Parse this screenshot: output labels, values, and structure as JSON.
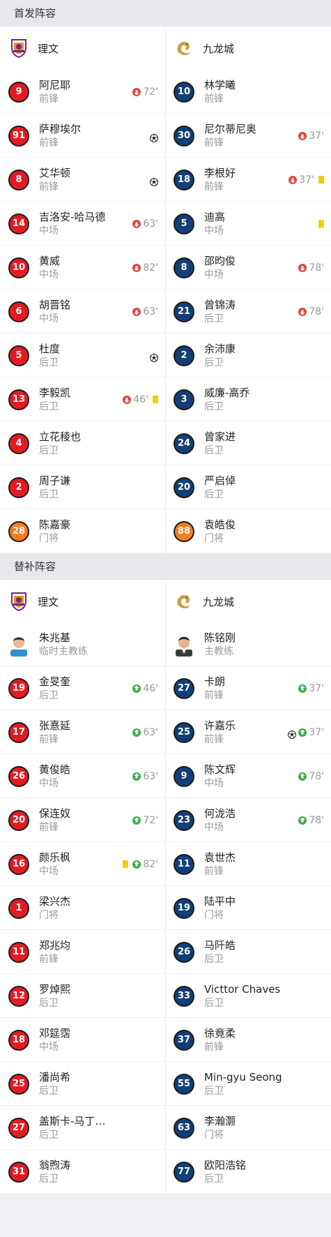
{
  "starting": {
    "title": "首发阵容",
    "home": {
      "team": "理文",
      "players": [
        {
          "number": "9",
          "name": "阿尼耶",
          "position": "前锋",
          "color": "red",
          "sub_out": "72'"
        },
        {
          "number": "91",
          "name": "萨穆埃尔",
          "position": "前锋",
          "color": "red",
          "goals": 1
        },
        {
          "number": "8",
          "name": "艾华顿",
          "position": "前锋",
          "color": "red",
          "goals": 1
        },
        {
          "number": "14",
          "name": "吉洛安-哈马德",
          "position": "中场",
          "color": "red",
          "sub_out": "63'"
        },
        {
          "number": "10",
          "name": "黄威",
          "position": "中场",
          "color": "red",
          "sub_out": "82'"
        },
        {
          "number": "6",
          "name": "胡晋铭",
          "position": "中场",
          "color": "red",
          "sub_out": "63'"
        },
        {
          "number": "5",
          "name": "杜度",
          "position": "后卫",
          "color": "red",
          "goals": 1
        },
        {
          "number": "13",
          "name": "李毅凯",
          "position": "后卫",
          "color": "red",
          "sub_out": "46'",
          "yellow": true
        },
        {
          "number": "4",
          "name": "立花稜也",
          "position": "后卫",
          "color": "red"
        },
        {
          "number": "2",
          "name": "周子谦",
          "position": "后卫",
          "color": "red"
        },
        {
          "number": "28",
          "name": "陈嘉豪",
          "position": "门将",
          "color": "orange"
        }
      ]
    },
    "away": {
      "team": "九龙城",
      "players": [
        {
          "number": "10",
          "name": "林学曦",
          "position": "前锋",
          "color": "navy"
        },
        {
          "number": "30",
          "name": "尼尔蒂尼奥",
          "position": "前锋",
          "color": "navy",
          "sub_out": "37'"
        },
        {
          "number": "18",
          "name": "李根好",
          "position": "前锋",
          "color": "navy",
          "sub_out": "37'",
          "yellow": true
        },
        {
          "number": "5",
          "name": "迪高",
          "position": "中场",
          "color": "navy",
          "yellow": true
        },
        {
          "number": "8",
          "name": "邵昀俊",
          "position": "中场",
          "color": "navy",
          "sub_out": "78'"
        },
        {
          "number": "21",
          "name": "曾锦涛",
          "position": "后卫",
          "color": "navy",
          "sub_out": "78'"
        },
        {
          "number": "2",
          "name": "余沛康",
          "position": "后卫",
          "color": "navy"
        },
        {
          "number": "3",
          "name": "威廉-高乔",
          "position": "后卫",
          "color": "navy"
        },
        {
          "number": "24",
          "name": "曾家进",
          "position": "后卫",
          "color": "navy"
        },
        {
          "number": "20",
          "name": "严启倬",
          "position": "后卫",
          "color": "navy"
        },
        {
          "number": "88",
          "name": "袁皓俊",
          "position": "门将",
          "color": "orange"
        }
      ]
    }
  },
  "substitutes": {
    "title": "替补阵容",
    "home": {
      "team": "理文",
      "coach": {
        "name": "朱兆基",
        "role": "临时主教练"
      },
      "players": [
        {
          "number": "19",
          "name": "金旻奎",
          "position": "后卫",
          "color": "red",
          "sub_in": "46'"
        },
        {
          "number": "17",
          "name": "张憙延",
          "position": "前锋",
          "color": "red",
          "sub_in": "63'"
        },
        {
          "number": "26",
          "name": "黄俊皓",
          "position": "中场",
          "color": "red",
          "sub_in": "63'"
        },
        {
          "number": "20",
          "name": "保连奴",
          "position": "前锋",
          "color": "red",
          "sub_in": "72'"
        },
        {
          "number": "16",
          "name": "颜乐枫",
          "position": "中场",
          "color": "red",
          "sub_in": "82'",
          "yellow": true
        },
        {
          "number": "1",
          "name": "梁兴杰",
          "position": "门将",
          "color": "red"
        },
        {
          "number": "11",
          "name": "郑兆均",
          "position": "前锋",
          "color": "red"
        },
        {
          "number": "12",
          "name": "罗焯熙",
          "position": "后卫",
          "color": "red"
        },
        {
          "number": "18",
          "name": "邓筵霑",
          "position": "中场",
          "color": "red"
        },
        {
          "number": "25",
          "name": "潘尚希",
          "position": "后卫",
          "color": "red"
        },
        {
          "number": "27",
          "name": "盖斯卡-马丁…",
          "position": "后卫",
          "color": "red"
        },
        {
          "number": "31",
          "name": "翁煦涛",
          "position": "后卫",
          "color": "red"
        }
      ]
    },
    "away": {
      "team": "九龙城",
      "coach": {
        "name": "陈铭刚",
        "role": "主教练"
      },
      "players": [
        {
          "number": "27",
          "name": "卡朗",
          "position": "前锋",
          "color": "navy",
          "sub_in": "37'"
        },
        {
          "number": "25",
          "name": "许嘉乐",
          "position": "前锋",
          "color": "navy",
          "sub_in": "37'",
          "goals": 1
        },
        {
          "number": "9",
          "name": "陈文辉",
          "position": "中场",
          "color": "navy",
          "sub_in": "78'"
        },
        {
          "number": "23",
          "name": "何泷浩",
          "position": "中场",
          "color": "navy",
          "sub_in": "78'"
        },
        {
          "number": "11",
          "name": "袁世杰",
          "position": "前锋",
          "color": "navy"
        },
        {
          "number": "19",
          "name": "陆平中",
          "position": "门将",
          "color": "navy"
        },
        {
          "number": "26",
          "name": "马阡皓",
          "position": "后卫",
          "color": "navy"
        },
        {
          "number": "33",
          "name": "Victtor Chaves",
          "position": "后卫",
          "color": "navy"
        },
        {
          "number": "37",
          "name": "徐竟柔",
          "position": "前锋",
          "color": "navy"
        },
        {
          "number": "55",
          "name": "Min-gyu Seong",
          "position": "后卫",
          "color": "navy"
        },
        {
          "number": "63",
          "name": "李瀚灏",
          "position": "门将",
          "color": "navy"
        },
        {
          "number": "77",
          "name": "欧阳浩铭",
          "position": "后卫",
          "color": "navy"
        }
      ]
    }
  },
  "colors": {
    "red": "#e31b23",
    "navy": "#123f77",
    "orange": "#f47b20",
    "sub_out": "#e0463c",
    "sub_in": "#3cb04a",
    "yellow": "#f4cc0c"
  },
  "icons": {
    "home_logo": "lee-man-crest-icon",
    "away_logo": "kowloon-city-dragon-icon",
    "goal": "football-icon",
    "sub_out": "sub-out-arrow-icon",
    "sub_in": "sub-in-arrow-icon"
  }
}
